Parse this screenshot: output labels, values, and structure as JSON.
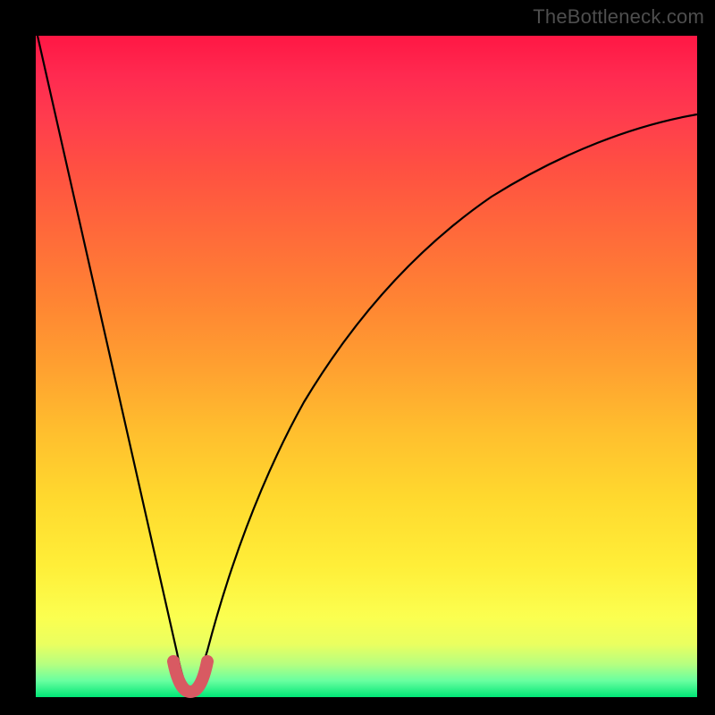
{
  "watermark": "TheBottleneck.com",
  "colors": {
    "frame": "#000000",
    "gradient_top": "#ff1744",
    "gradient_mid": "#ffd92e",
    "gradient_bottom": "#00e676",
    "curve": "#000000",
    "marker": "#d85a62"
  },
  "chart_data": {
    "type": "line",
    "title": "",
    "xlabel": "",
    "ylabel": "",
    "xlim": [
      0,
      100
    ],
    "ylim": [
      0,
      100
    ],
    "x": [
      0,
      2,
      4,
      6,
      8,
      10,
      12,
      14,
      16,
      18,
      20,
      21,
      22,
      23,
      24,
      25,
      26,
      28,
      30,
      32,
      35,
      40,
      45,
      50,
      55,
      60,
      65,
      70,
      75,
      80,
      85,
      90,
      95,
      100
    ],
    "values": [
      100,
      89,
      78,
      67,
      57,
      47,
      38,
      30,
      22,
      14,
      7,
      4,
      2,
      1,
      1,
      2,
      5,
      12,
      19,
      26,
      34,
      45,
      54,
      61,
      66,
      71,
      74,
      77,
      80,
      82,
      84,
      85.5,
      87,
      88
    ],
    "markers": {
      "x": [
        20.5,
        21.5,
        22.5,
        23.5,
        24.5,
        25.5
      ],
      "y": [
        5,
        2,
        1,
        1,
        2,
        5
      ]
    },
    "annotations": []
  }
}
